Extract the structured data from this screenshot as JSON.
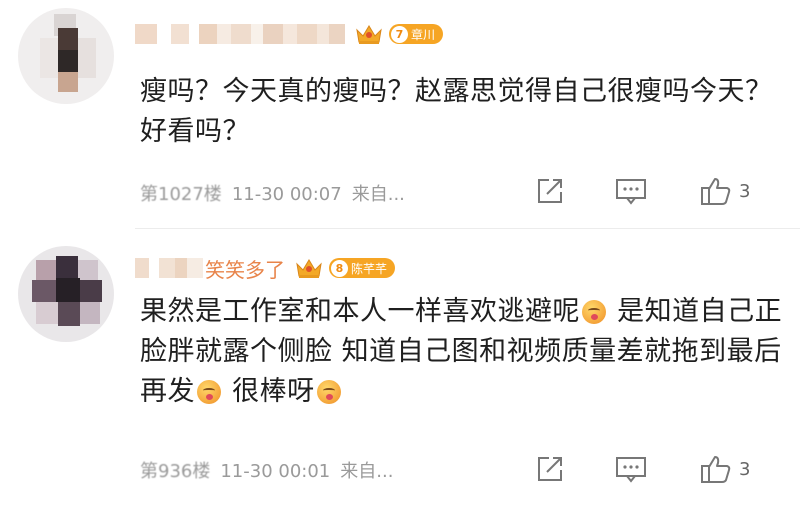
{
  "comments": [
    {
      "fan_badge": {
        "level": "7",
        "name": "章川"
      },
      "text": "瘦吗？今天真的瘦吗？赵露思觉得自己很瘦吗今天？好看吗？",
      "floor": "第1027楼",
      "time": "11-30 00:07",
      "source": "来自...",
      "likes": "3"
    },
    {
      "name_tail": "笑笑多了",
      "fan_badge": {
        "level": "8",
        "name": "陈芊芊"
      },
      "text_parts": [
        "果然是工作室和本人一样喜欢逃避呢",
        "是知道自己正脸胖就露个侧脸 知道自己图和视频质量差就拖到最后再发",
        "很棒呀"
      ],
      "floor": "第936楼",
      "time": "11-30 00:01",
      "source": "来自...",
      "likes": "3"
    }
  ],
  "icons": {
    "crown": "crown-icon",
    "share": "share-icon",
    "comment": "comment-icon",
    "like": "thumbs-up-icon",
    "emoji": "tongue-emoji-icon"
  },
  "colors": {
    "badge": "#f6a524",
    "name_tail": "#e8844a",
    "meta": "#9a9a9a"
  }
}
